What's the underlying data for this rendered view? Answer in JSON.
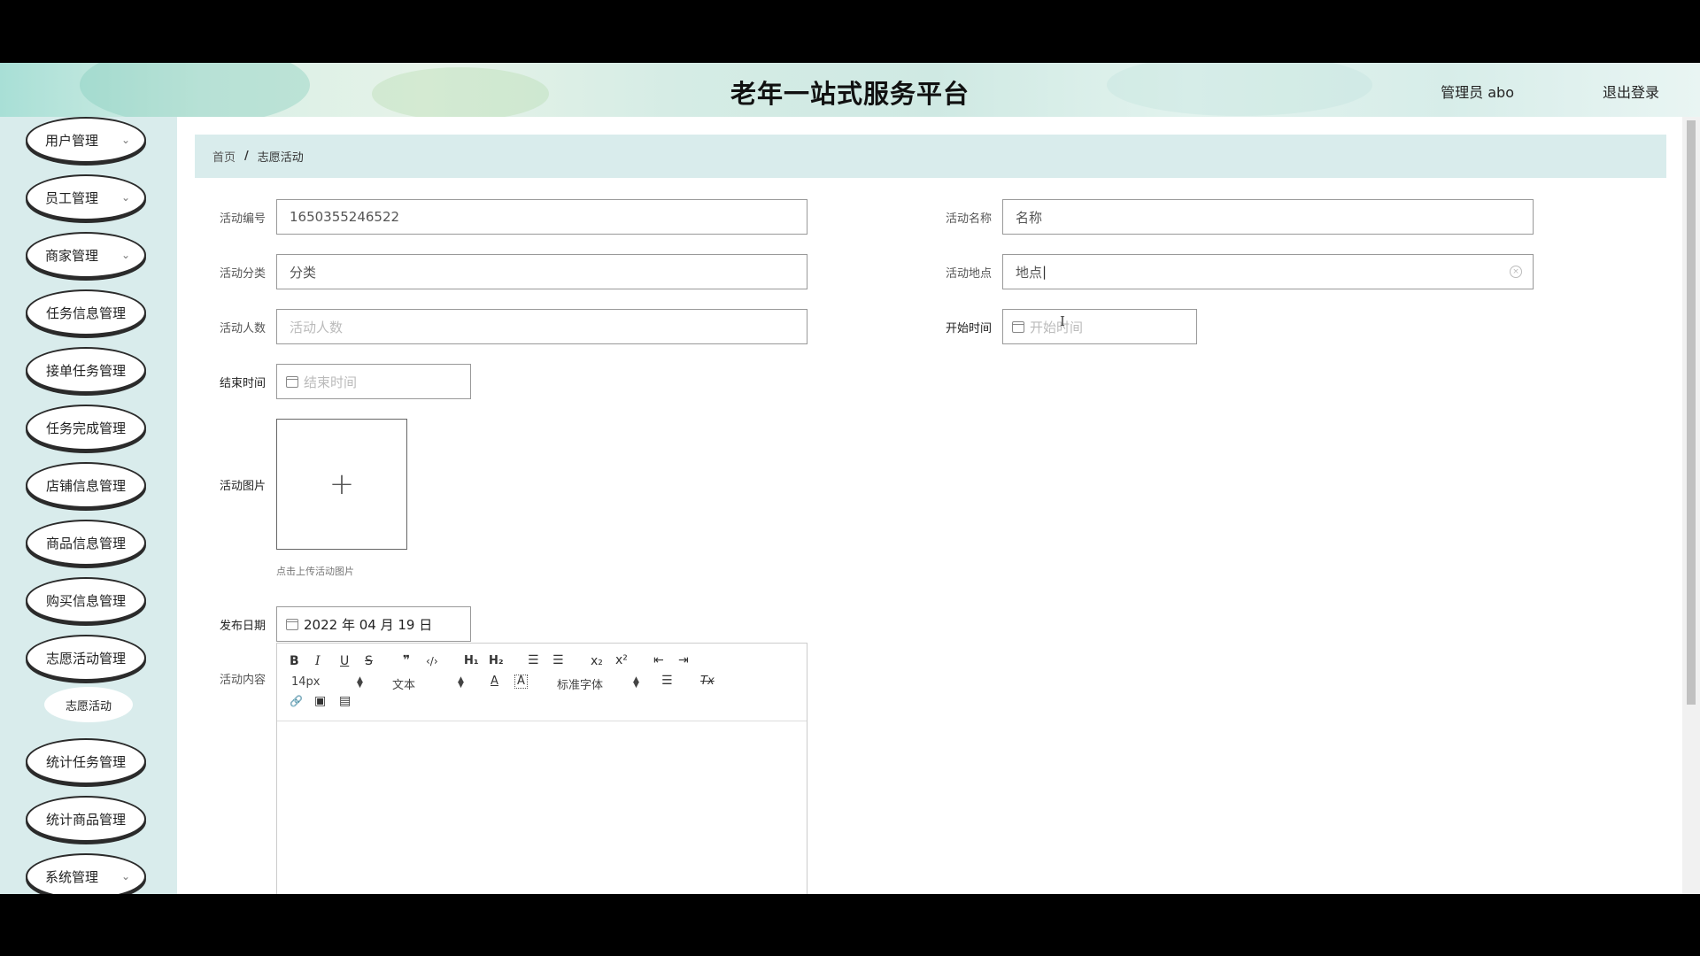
{
  "header": {
    "title": "老年一站式服务平台",
    "user": "管理员 abo",
    "logout": "退出登录"
  },
  "sidebar": {
    "items": [
      {
        "label": "用户管理",
        "arrow": true
      },
      {
        "label": "员工管理",
        "arrow": true
      },
      {
        "label": "商家管理",
        "arrow": true
      },
      {
        "label": "任务信息管理",
        "arrow": false
      },
      {
        "label": "接单任务管理",
        "arrow": false
      },
      {
        "label": "任务完成管理",
        "arrow": false
      },
      {
        "label": "店铺信息管理",
        "arrow": false
      },
      {
        "label": "商品信息管理",
        "arrow": false
      },
      {
        "label": "购买信息管理",
        "arrow": false
      },
      {
        "label": "志愿活动管理",
        "arrow": false
      },
      {
        "label": "统计任务管理",
        "arrow": false
      },
      {
        "label": "统计商品管理",
        "arrow": false
      },
      {
        "label": "系统管理",
        "arrow": true
      }
    ],
    "submenu": "志愿活动",
    "arrow_glyph": "⌄"
  },
  "breadcrumb": {
    "home": "首页",
    "sep": "/",
    "current": "志愿活动"
  },
  "form": {
    "activity_id": {
      "label": "活动编号",
      "value": "1650355246522"
    },
    "activity_name": {
      "label": "活动名称",
      "value": "名称"
    },
    "category": {
      "label": "活动分类",
      "value": "分类"
    },
    "location": {
      "label": "活动地点",
      "value": "地点"
    },
    "headcount": {
      "label": "活动人数",
      "placeholder": "活动人数"
    },
    "start_time": {
      "label": "开始时间",
      "placeholder": "开始时间"
    },
    "end_time": {
      "label": "结束时间",
      "placeholder": "结束时间"
    },
    "image": {
      "label": "活动图片",
      "tip": "点击上传活动图片",
      "plus": "+"
    },
    "publish_date": {
      "label": "发布日期",
      "value": "2022 年 04 月 19 日"
    },
    "content": {
      "label": "活动内容"
    }
  },
  "editor": {
    "bold": "B",
    "italic": "I",
    "underline": "U",
    "strike": "S",
    "quote": "❞",
    "code": "‹/›",
    "h1": "H₁",
    "h2": "H₂",
    "ol": "☰",
    "ul": "☰",
    "sub": "x₂",
    "sup": "x²",
    "outdent": "⇤",
    "indent": "⇥",
    "size": "14px",
    "block": "文本",
    "color": "A",
    "bg": "A",
    "font": "标准字体",
    "align": "☰",
    "clean": "Tx",
    "link": "🔗",
    "image": "▣",
    "video": "▤"
  }
}
